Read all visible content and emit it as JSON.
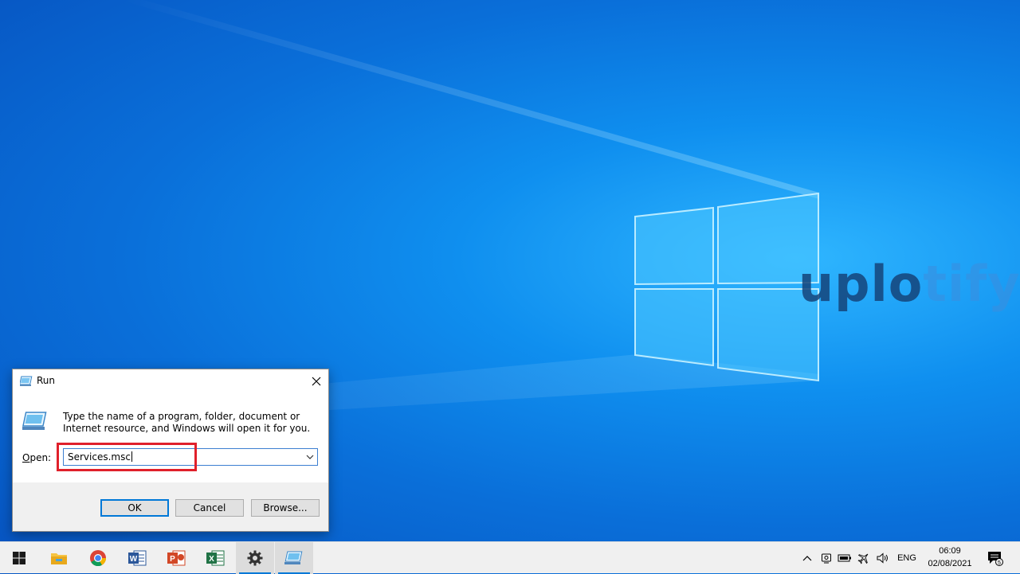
{
  "desktop": {
    "watermark": {
      "dark": "uplo",
      "light": "tify"
    }
  },
  "run_dialog": {
    "title": "Run",
    "description": "Type the name of a program, folder, document or Internet resource, and Windows will open it for you.",
    "open_label_accel": "O",
    "open_label_rest": "pen:",
    "open_value": "Services.msc",
    "buttons": {
      "ok": "OK",
      "cancel": "Cancel",
      "browse": "Browse..."
    },
    "highlight_color": "#e0202b"
  },
  "taskbar": {
    "apps": [
      {
        "name": "start",
        "icon": "windows-start-icon"
      },
      {
        "name": "file-explorer",
        "icon": "folder-icon"
      },
      {
        "name": "chrome",
        "icon": "chrome-icon"
      },
      {
        "name": "word",
        "icon": "word-icon"
      },
      {
        "name": "powerpoint",
        "icon": "powerpoint-icon"
      },
      {
        "name": "excel",
        "icon": "excel-icon"
      },
      {
        "name": "settings",
        "icon": "gear-icon"
      },
      {
        "name": "run",
        "icon": "run-icon",
        "active": true
      }
    ],
    "tray": {
      "language": "ENG",
      "time": "06:09",
      "date": "02/08/2021",
      "notification_count": "5"
    }
  },
  "colors": {
    "accent": "#0078d7",
    "word": "#2b579a",
    "powerpoint": "#d24726",
    "excel": "#217346"
  }
}
